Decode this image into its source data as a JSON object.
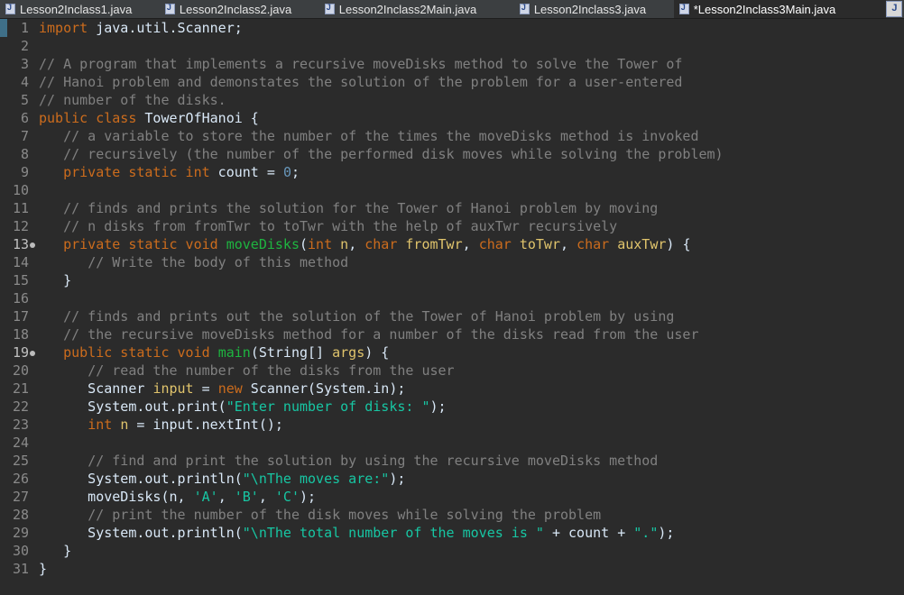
{
  "tabs": [
    {
      "label": "Lesson2Inclass1.java",
      "active": false
    },
    {
      "label": "Lesson2Inclass2.java",
      "active": false
    },
    {
      "label": "Lesson2Inclass2Main.java",
      "active": false
    },
    {
      "label": "Lesson2Inclass3.java",
      "active": false
    },
    {
      "label": "*Lesson2Inclass3Main.java",
      "active": true
    }
  ],
  "editor": {
    "lines": [
      [
        {
          "t": "import",
          "c": "kw"
        },
        {
          "t": " java.util.Scanner;"
        }
      ],
      [],
      [
        {
          "t": "// A program that implements a recursive moveDisks method to solve the Tower of",
          "c": "cm"
        }
      ],
      [
        {
          "t": "// Hanoi problem and demonstates the solution of the problem for a user-entered",
          "c": "cm"
        }
      ],
      [
        {
          "t": "// number of the disks.",
          "c": "cm"
        }
      ],
      [
        {
          "t": "public class",
          "c": "kw"
        },
        {
          "t": " TowerOfHanoi {"
        }
      ],
      [
        {
          "t": "   "
        },
        {
          "t": "// a variable to store the number of the times the moveDisks method is invoked",
          "c": "cm"
        }
      ],
      [
        {
          "t": "   "
        },
        {
          "t": "// recursively (the number of the performed disk moves while solving the problem)",
          "c": "cm"
        }
      ],
      [
        {
          "t": "   "
        },
        {
          "t": "private static int",
          "c": "kw"
        },
        {
          "t": " count = "
        },
        {
          "t": "0",
          "c": "nm"
        },
        {
          "t": ";"
        }
      ],
      [],
      [
        {
          "t": "   "
        },
        {
          "t": "// finds and prints the solution for the Tower of Hanoi problem by moving",
          "c": "cm"
        }
      ],
      [
        {
          "t": "   "
        },
        {
          "t": "// n disks from fromTwr to toTwr with the help of auxTwr recursively",
          "c": "cm"
        }
      ],
      [
        {
          "t": "   "
        },
        {
          "t": "private static void",
          "c": "kw"
        },
        {
          "t": " "
        },
        {
          "t": "moveDisks",
          "c": "fn"
        },
        {
          "t": "("
        },
        {
          "t": "int",
          "c": "kw"
        },
        {
          "t": " "
        },
        {
          "t": "n",
          "c": "pm"
        },
        {
          "t": ", "
        },
        {
          "t": "char",
          "c": "kw"
        },
        {
          "t": " "
        },
        {
          "t": "fromTwr",
          "c": "pm"
        },
        {
          "t": ", "
        },
        {
          "t": "char",
          "c": "kw"
        },
        {
          "t": " "
        },
        {
          "t": "toTwr",
          "c": "pm"
        },
        {
          "t": ", "
        },
        {
          "t": "char",
          "c": "kw"
        },
        {
          "t": " "
        },
        {
          "t": "auxTwr",
          "c": "pm"
        },
        {
          "t": ") {"
        }
      ],
      [
        {
          "t": "      "
        },
        {
          "t": "// Write the body of this method",
          "c": "cm"
        }
      ],
      [
        {
          "t": "   }"
        }
      ],
      [],
      [
        {
          "t": "   "
        },
        {
          "t": "// finds and prints out the solution of the Tower of Hanoi problem by using",
          "c": "cm"
        }
      ],
      [
        {
          "t": "   "
        },
        {
          "t": "// the recursive moveDisks method for a number of the disks read from the user",
          "c": "cm"
        }
      ],
      [
        {
          "t": "   "
        },
        {
          "t": "public static void",
          "c": "kw"
        },
        {
          "t": " "
        },
        {
          "t": "main",
          "c": "fn"
        },
        {
          "t": "(String[] "
        },
        {
          "t": "args",
          "c": "pm"
        },
        {
          "t": ") {"
        }
      ],
      [
        {
          "t": "      "
        },
        {
          "t": "// read the number of the disks from the user",
          "c": "cm"
        }
      ],
      [
        {
          "t": "      Scanner "
        },
        {
          "t": "input",
          "c": "pm"
        },
        {
          "t": " = "
        },
        {
          "t": "new",
          "c": "kw"
        },
        {
          "t": " Scanner(System.in);"
        }
      ],
      [
        {
          "t": "      System.out.print("
        },
        {
          "t": "\"Enter number of disks: \"",
          "c": "st"
        },
        {
          "t": ");"
        }
      ],
      [
        {
          "t": "      "
        },
        {
          "t": "int",
          "c": "kw"
        },
        {
          "t": " "
        },
        {
          "t": "n",
          "c": "pm"
        },
        {
          "t": " = input.nextInt();"
        }
      ],
      [],
      [
        {
          "t": "      "
        },
        {
          "t": "// find and print the solution by using the recursive moveDisks method",
          "c": "cm"
        }
      ],
      [
        {
          "t": "      System.out.println("
        },
        {
          "t": "\"\\nThe moves are:\"",
          "c": "st"
        },
        {
          "t": ");"
        }
      ],
      [
        {
          "t": "      moveDisks(n, "
        },
        {
          "t": "'A'",
          "c": "st"
        },
        {
          "t": ", "
        },
        {
          "t": "'B'",
          "c": "st"
        },
        {
          "t": ", "
        },
        {
          "t": "'C'",
          "c": "st"
        },
        {
          "t": ");"
        }
      ],
      [
        {
          "t": "      "
        },
        {
          "t": "// print the number of the disk moves while solving the problem",
          "c": "cm"
        }
      ],
      [
        {
          "t": "      System.out.println("
        },
        {
          "t": "\"\\nThe total number of the moves is \"",
          "c": "st"
        },
        {
          "t": " + count + "
        },
        {
          "t": "\".\"",
          "c": "st"
        },
        {
          "t": ");"
        }
      ],
      [
        {
          "t": "   }"
        }
      ],
      [
        {
          "t": "}"
        }
      ]
    ]
  }
}
